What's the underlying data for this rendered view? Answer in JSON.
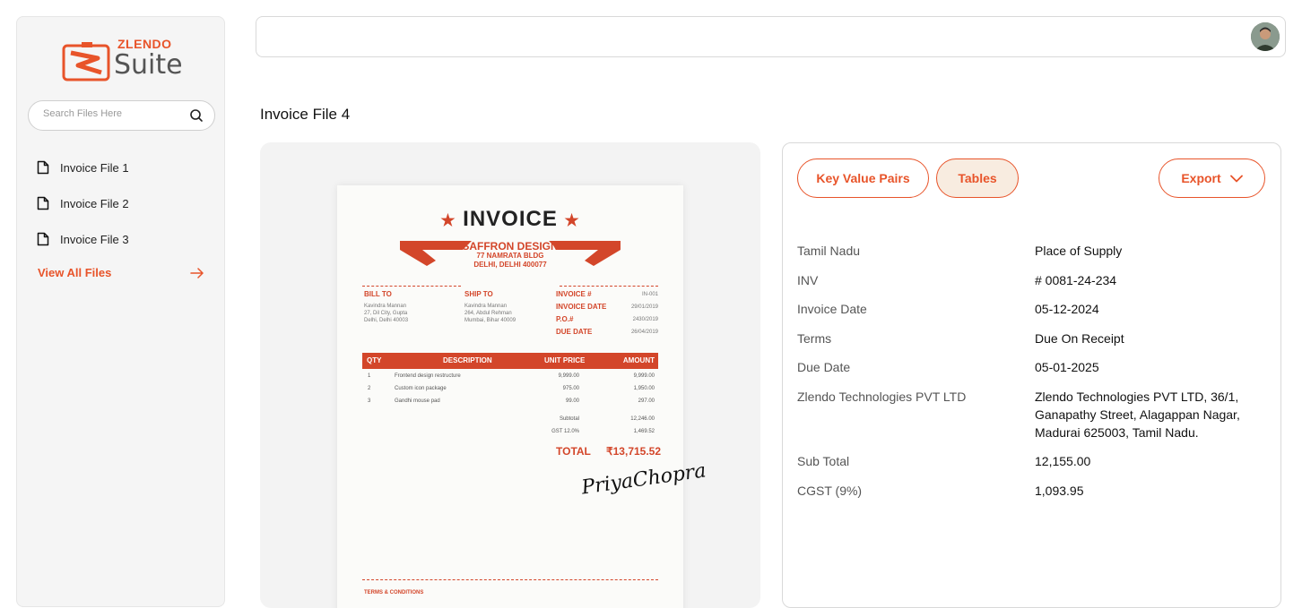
{
  "brand": {
    "small": "ZLENDO",
    "big": "Suite"
  },
  "sidebar": {
    "search_placeholder": "Search Files Here",
    "files": [
      {
        "label": "Invoice File 1"
      },
      {
        "label": "Invoice File 2"
      },
      {
        "label": "Invoice File 3"
      }
    ],
    "view_all": "View All Files"
  },
  "main": {
    "title": "Invoice File 4"
  },
  "invoice_doc": {
    "title": "INVOICE",
    "company_name": "SAFFRON DESIGN",
    "company_addr1": "77 NAMRATA BLDG",
    "company_addr2": "DELHI, DELHI 400077",
    "bill_to_label": "BILL TO",
    "bill_to": [
      "Kavindra Mannan",
      "27, Dil City, Gupta",
      "Delhi, Delhi 40003"
    ],
    "ship_to_label": "SHIP TO",
    "ship_to": [
      "Kavindra Mannan",
      "264, Abdul Rehman",
      "Mumbai, Bihar 40009"
    ],
    "meta_labels": [
      "INVOICE #",
      "INVOICE DATE",
      "P.O.#",
      "DUE DATE"
    ],
    "meta_values": [
      "IN-001",
      "29/01/2019",
      "2430/2019",
      "26/04/2019"
    ],
    "col_qty": "QTY",
    "col_desc": "DESCRIPTION",
    "col_price": "UNIT PRICE",
    "col_amount": "AMOUNT",
    "items": [
      {
        "qty": "1",
        "desc": "Frontend design restructure",
        "price": "9,999.00",
        "amount": "9,999.00"
      },
      {
        "qty": "2",
        "desc": "Custom icon package",
        "price": "975.00",
        "amount": "1,950.00"
      },
      {
        "qty": "3",
        "desc": "Gandhi mouse pad",
        "price": "99.00",
        "amount": "297.00"
      }
    ],
    "subtotal_label": "Subtotal",
    "subtotal_value": "12,246.00",
    "gst_label": "GST 12.0%",
    "gst_value": "1,469.52",
    "total_label": "TOTAL",
    "total_value": "₹13,715.52",
    "signature": "PriyaChopra",
    "terms_label": "TERMS & CONDITIONS"
  },
  "panel": {
    "tabs": [
      {
        "label": "Key Value Pairs",
        "active": false
      },
      {
        "label": "Tables",
        "active": true
      }
    ],
    "export_label": "Export",
    "pairs": [
      {
        "key": "Tamil Nadu",
        "value": "Place of Supply"
      },
      {
        "key": "INV",
        "value": "# 0081-24-234"
      },
      {
        "key": "Invoice Date",
        "value": "05-12-2024"
      },
      {
        "key": "Terms",
        "value": "Due On Receipt"
      },
      {
        "key": "Due Date",
        "value": "05-01-2025"
      },
      {
        "key": "Zlendo Technologies PVT LTD",
        "value": "Zlendo Technologies PVT LTD, 36/1, Ganapathy Street, Alagappan Nagar, Madurai 625003, Tamil Nadu."
      },
      {
        "key": "Sub Total",
        "value": "12,155.00"
      },
      {
        "key": "CGST (9%)",
        "value": "1,093.95"
      }
    ]
  },
  "colors": {
    "accent": "#e8542a",
    "invoice_red": "#d3462a",
    "active_tab_bg": "#f8ece0"
  }
}
